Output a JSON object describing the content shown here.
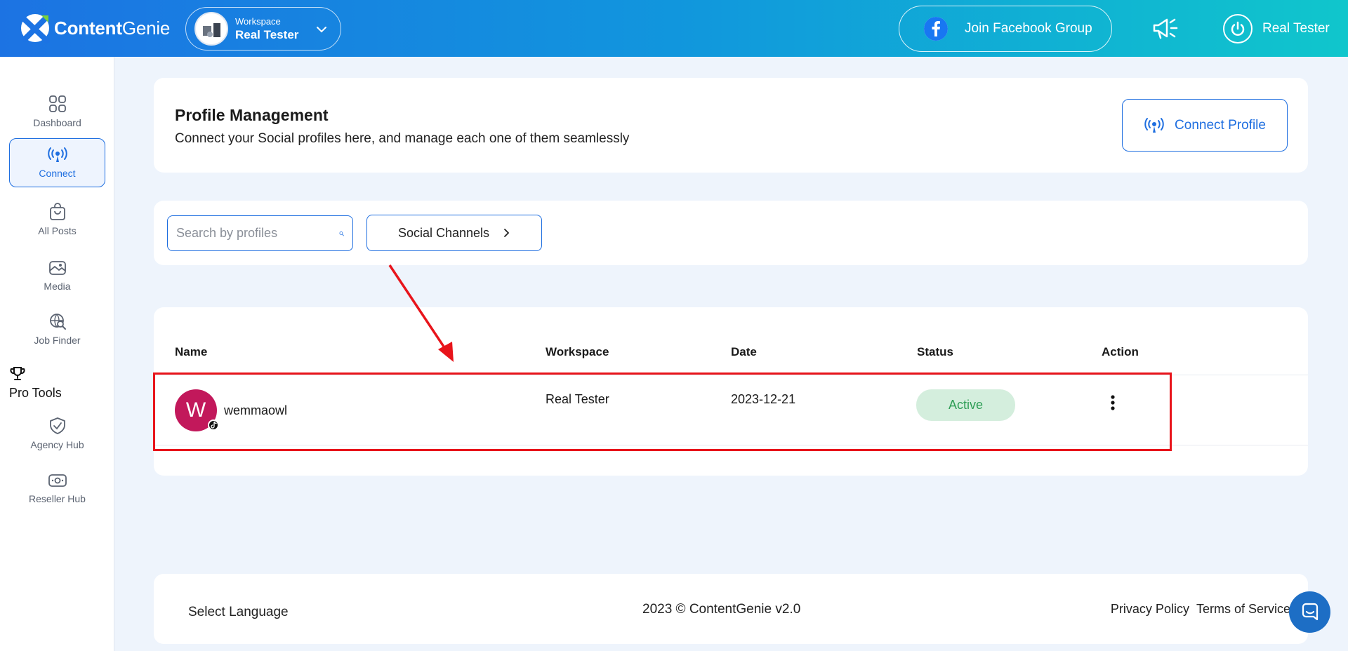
{
  "header": {
    "logo_brand": "Content",
    "logo_brand2": "Genie",
    "workspace_label": "Workspace",
    "workspace_name": "Real Tester",
    "facebook_button": "Join Facebook Group",
    "user_name": "Real Tester"
  },
  "sidebar": {
    "items": [
      {
        "label": "Dashboard",
        "icon": "grid-icon"
      },
      {
        "label": "Connect",
        "icon": "broadcast-icon"
      },
      {
        "label": "All Posts",
        "icon": "shopping-bag-icon"
      },
      {
        "label": "Media",
        "icon": "image-icon"
      },
      {
        "label": "Job Finder",
        "icon": "search-globe-icon"
      },
      {
        "label": "Agency Hub",
        "icon": "shield-check-icon"
      },
      {
        "label": "Reseller Hub",
        "icon": "money-icon"
      }
    ],
    "pro_tools_label": "Pro Tools",
    "active_color": "#1e6ee0"
  },
  "profile_management": {
    "title": "Profile Management",
    "subtitle": "Connect your Social profiles here, and manage each one of them seamlessly",
    "connect_button": "Connect Profile"
  },
  "filters": {
    "search_placeholder": "Search by profiles",
    "channels_button": "Social Channels"
  },
  "table": {
    "columns": [
      "Name",
      "Workspace",
      "Date",
      "Status",
      "Action"
    ],
    "rows": [
      {
        "avatar_letter": "W",
        "name": "wemmaowl",
        "platform_icon": "tiktok-icon",
        "workspace": "Real Tester",
        "date": "2023-12-21",
        "status": "Active"
      }
    ]
  },
  "footer": {
    "language": "Select Language",
    "copyright": "2023 © ContentGenie v2.0",
    "privacy": "Privacy Policy",
    "terms": "Terms of Service"
  },
  "colors": {
    "accent": "#1e6ee0",
    "annotation_red": "#e8141b",
    "avatar_bg": "#c2185b",
    "status_bg": "#d4eedd",
    "status_text": "#2f9e56"
  }
}
